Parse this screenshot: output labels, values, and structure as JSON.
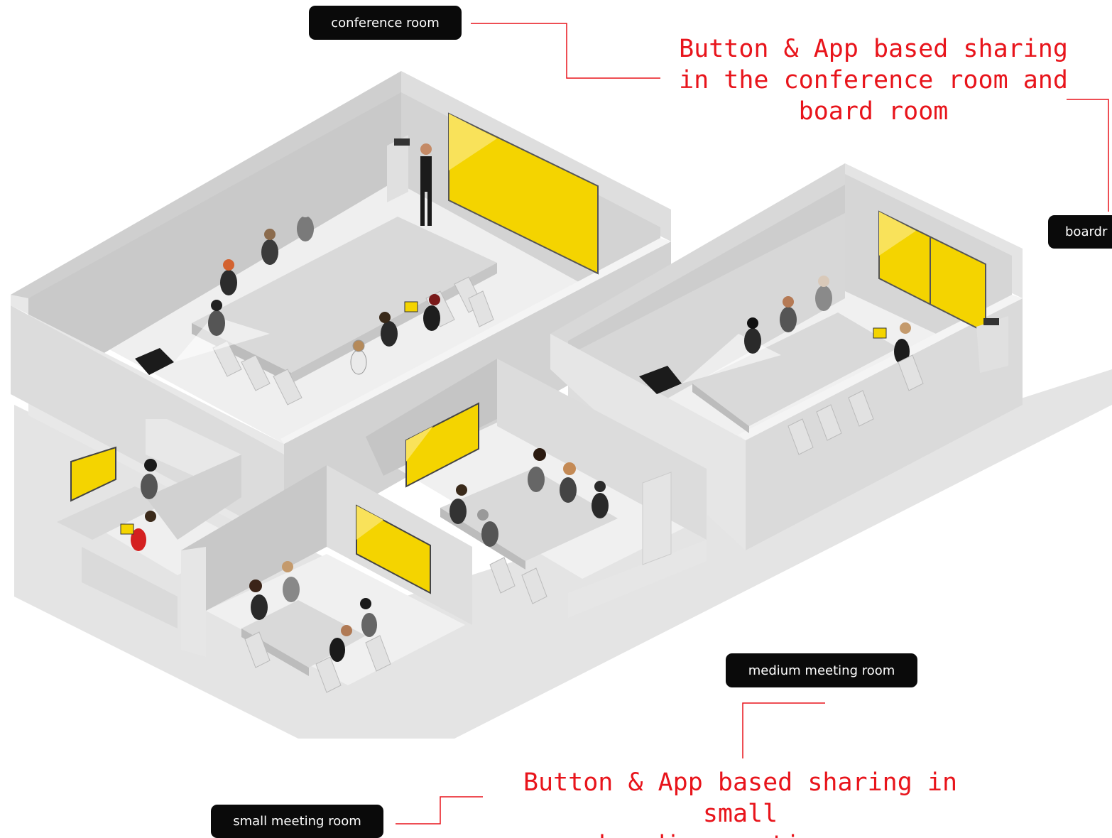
{
  "labels": {
    "conference_room": "conference room",
    "boardroom": "boardr",
    "medium_meeting_room": "medium meeting room",
    "small_meeting_room": "small meeting room"
  },
  "callouts": {
    "top": "Button & App based sharing\nin the conference room and\nboard room",
    "bottom": "Button & App based sharing in small\nand medium meeting rooms"
  },
  "colors": {
    "callout_text": "#e8141b",
    "callout_line": "#e8141b",
    "label_pill": "#0a0a0a",
    "display_screen": "#f4d400",
    "wall_light": "#e6e6e6",
    "wall_dark": "#bdbdbd",
    "floor": "#f0f0f0",
    "shadow": "#dcdcdc"
  }
}
